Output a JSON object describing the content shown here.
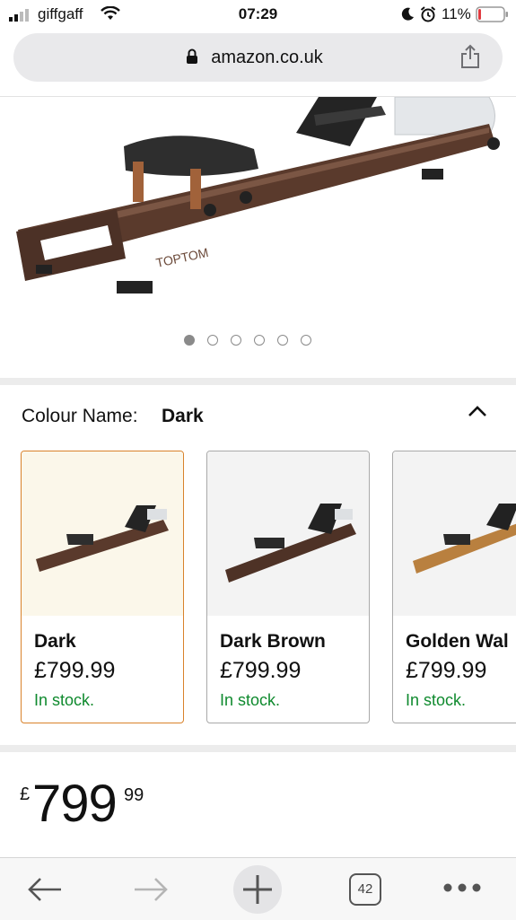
{
  "status": {
    "carrier": "giffgaff",
    "time": "07:29",
    "battery_pct": "11%",
    "battery_level": 0.11
  },
  "browser": {
    "url": "amazon.co.uk",
    "tab_count": "42"
  },
  "gallery": {
    "total_images": 6,
    "active_index": 0
  },
  "colour": {
    "label": "Colour Name:",
    "selected": "Dark",
    "options": [
      {
        "name": "Dark",
        "price": "£799.99",
        "stock": "In stock."
      },
      {
        "name": "Dark Brown",
        "price": "£799.99",
        "stock": "In stock."
      },
      {
        "name": "Golden Wal",
        "price": "£799.99",
        "stock": "In stock."
      }
    ]
  },
  "price": {
    "currency": "£",
    "whole": "799",
    "fraction": "99"
  },
  "colors": {
    "accent_selected": "#d9822b",
    "in_stock": "#0f8a2e",
    "battery_low": "#e0393e"
  }
}
